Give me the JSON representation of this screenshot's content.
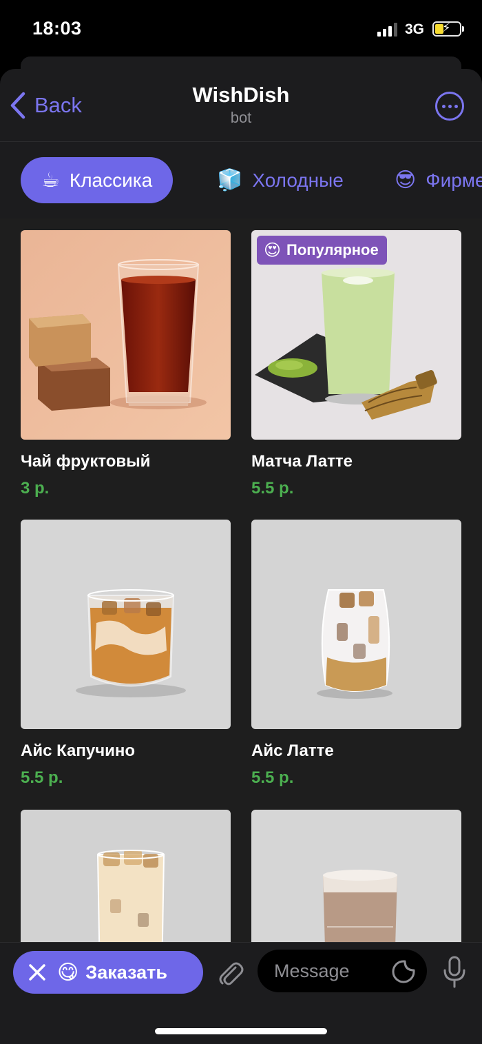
{
  "status": {
    "time": "18:03",
    "network": "3G"
  },
  "header": {
    "back_label": "Back",
    "title": "WishDish",
    "subtitle": "bot"
  },
  "tabs": [
    {
      "emoji": "☕",
      "label": "Классика",
      "active": true
    },
    {
      "emoji": "🧊",
      "label": "Холодные",
      "active": false
    },
    {
      "emoji": "😎",
      "label": "Фирменные",
      "active": false
    }
  ],
  "products": [
    {
      "name": "Чай фруктовый",
      "price": "3 р.",
      "badge": ""
    },
    {
      "name": "Матча Латте",
      "price": "5.5 р.",
      "badge": "Популярное",
      "badge_emoji": "😍"
    },
    {
      "name": "Айс Капучино",
      "price": "5.5 р.",
      "badge": ""
    },
    {
      "name": "Айс Латте",
      "price": "5.5 р.",
      "badge": ""
    },
    {
      "name": "",
      "price": "",
      "badge": ""
    },
    {
      "name": "",
      "price": "",
      "badge": ""
    }
  ],
  "bottom": {
    "order_emoji": "😋",
    "order_label": "Заказать",
    "message_placeholder": "Message"
  },
  "colors": {
    "accent": "#6e67e8",
    "price": "#4caf50",
    "badge": "#7e53b8",
    "background": "#1c1c1e"
  },
  "icons": [
    "chevron-left-icon",
    "more-icon",
    "close-icon",
    "paperclip-icon",
    "sticker-icon",
    "microphone-icon"
  ]
}
